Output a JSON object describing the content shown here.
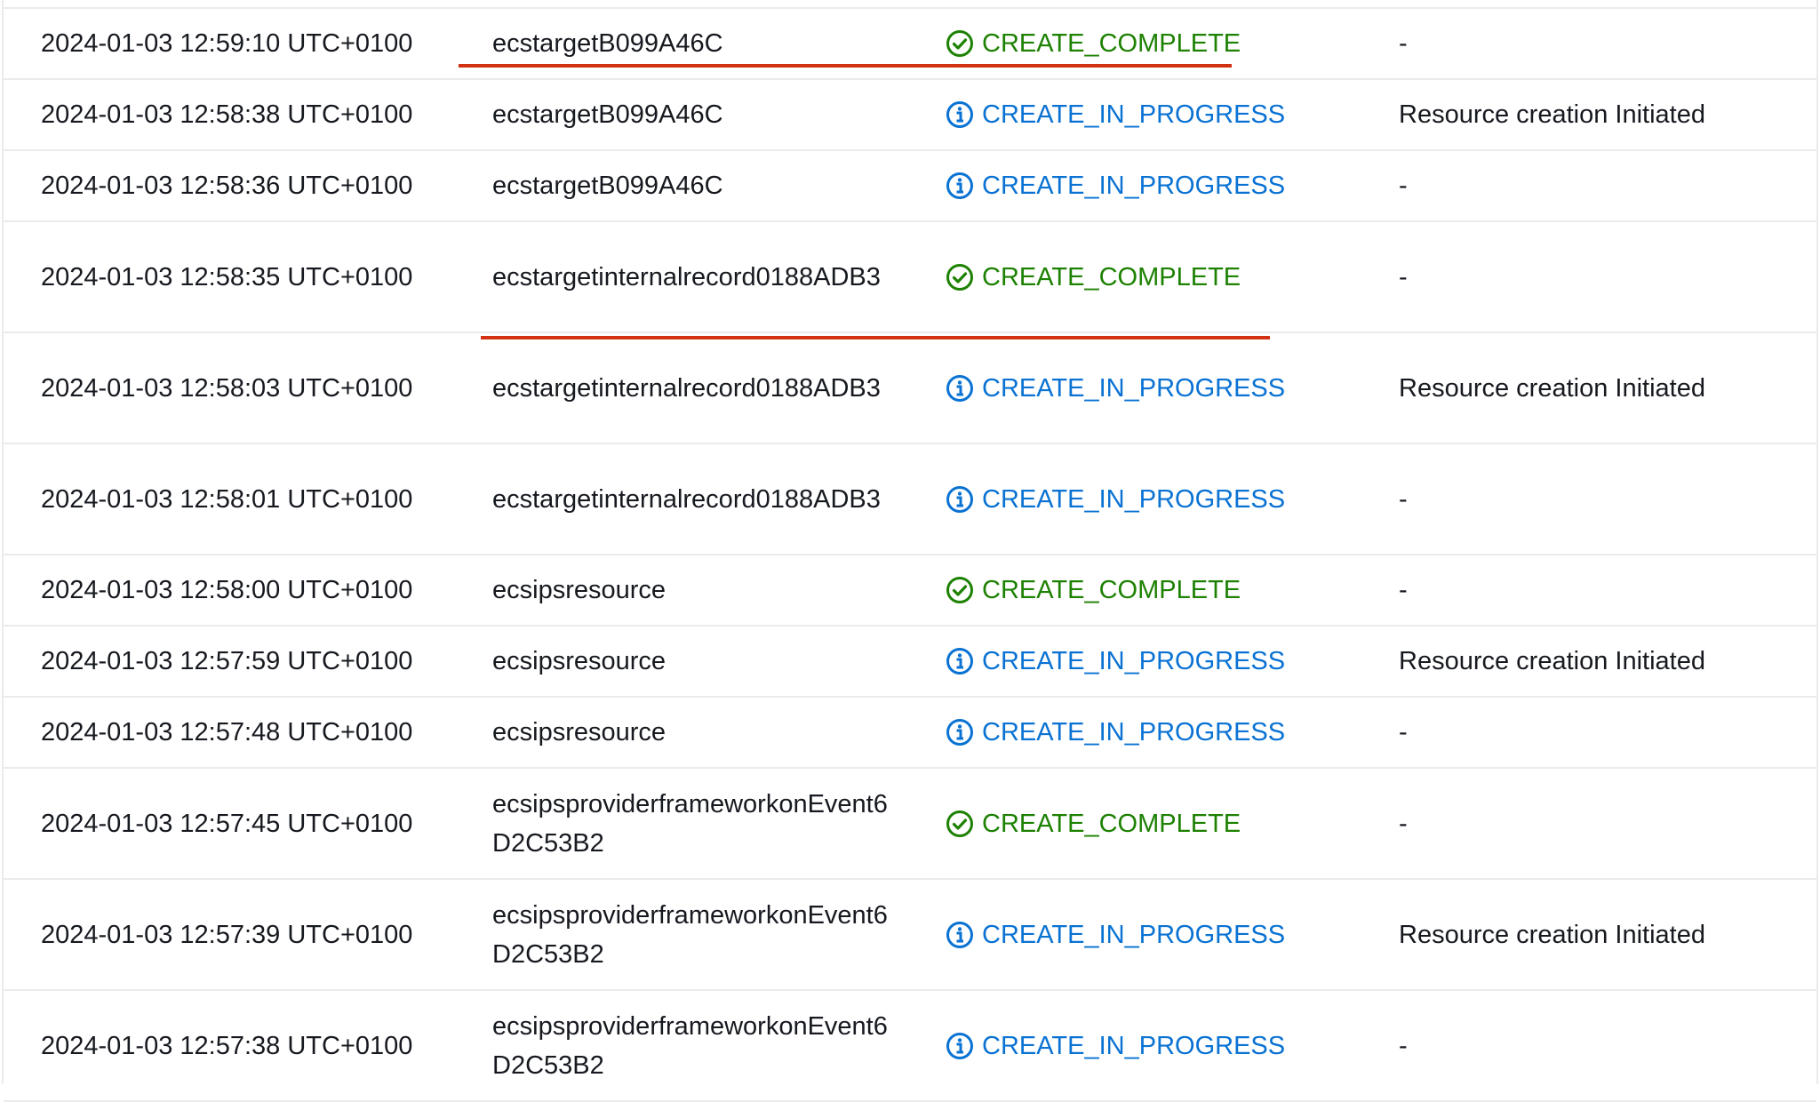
{
  "colors": {
    "complete": "#1d8102",
    "in_progress": "#0972d3",
    "annotation": "#d13212"
  },
  "events": [
    {
      "timestamp": "2024-01-03 12:59:10 UTC+0100",
      "logical_id": "ecstargetB099A46C",
      "status": "CREATE_COMPLETE",
      "status_type": "complete",
      "status_icon": "check-circle-icon",
      "reason": "-"
    },
    {
      "timestamp": "2024-01-03 12:58:38 UTC+0100",
      "logical_id": "ecstargetB099A46C",
      "status": "CREATE_IN_PROGRESS",
      "status_type": "progress",
      "status_icon": "info-circle-icon",
      "reason": "Resource creation Initiated"
    },
    {
      "timestamp": "2024-01-03 12:58:36 UTC+0100",
      "logical_id": "ecstargetB099A46C",
      "status": "CREATE_IN_PROGRESS",
      "status_type": "progress",
      "status_icon": "info-circle-icon",
      "reason": "-"
    },
    {
      "timestamp": "2024-01-03 12:58:35 UTC+0100",
      "logical_id": "ecstargetinternalrecord0188ADB3",
      "status": "CREATE_COMPLETE",
      "status_type": "complete",
      "status_icon": "check-circle-icon",
      "reason": "-"
    },
    {
      "timestamp": "2024-01-03 12:58:03 UTC+0100",
      "logical_id": "ecstargetinternalrecord0188ADB3",
      "status": "CREATE_IN_PROGRESS",
      "status_type": "progress",
      "status_icon": "info-circle-icon",
      "reason": "Resource creation Initiated"
    },
    {
      "timestamp": "2024-01-03 12:58:01 UTC+0100",
      "logical_id": "ecstargetinternalrecord0188ADB3",
      "status": "CREATE_IN_PROGRESS",
      "status_type": "progress",
      "status_icon": "info-circle-icon",
      "reason": "-"
    },
    {
      "timestamp": "2024-01-03 12:58:00 UTC+0100",
      "logical_id": "ecsipsresource",
      "status": "CREATE_COMPLETE",
      "status_type": "complete",
      "status_icon": "check-circle-icon",
      "reason": "-"
    },
    {
      "timestamp": "2024-01-03 12:57:59 UTC+0100",
      "logical_id": "ecsipsresource",
      "status": "CREATE_IN_PROGRESS",
      "status_type": "progress",
      "status_icon": "info-circle-icon",
      "reason": "Resource creation Initiated"
    },
    {
      "timestamp": "2024-01-03 12:57:48 UTC+0100",
      "logical_id": "ecsipsresource",
      "status": "CREATE_IN_PROGRESS",
      "status_type": "progress",
      "status_icon": "info-circle-icon",
      "reason": "-"
    },
    {
      "timestamp": "2024-01-03 12:57:45 UTC+0100",
      "logical_id": "ecsipsproviderframeworkonEvent6D2C53B2",
      "status": "CREATE_COMPLETE",
      "status_type": "complete",
      "status_icon": "check-circle-icon",
      "reason": "-"
    },
    {
      "timestamp": "2024-01-03 12:57:39 UTC+0100",
      "logical_id": "ecsipsproviderframeworkonEvent6D2C53B2",
      "status": "CREATE_IN_PROGRESS",
      "status_type": "progress",
      "status_icon": "info-circle-icon",
      "reason": "Resource creation Initiated"
    },
    {
      "timestamp": "2024-01-03 12:57:38 UTC+0100",
      "logical_id": "ecsipsproviderframeworkonEvent6D2C53B2",
      "status": "CREATE_IN_PROGRESS",
      "status_type": "progress",
      "status_icon": "info-circle-icon",
      "reason": "-"
    }
  ]
}
